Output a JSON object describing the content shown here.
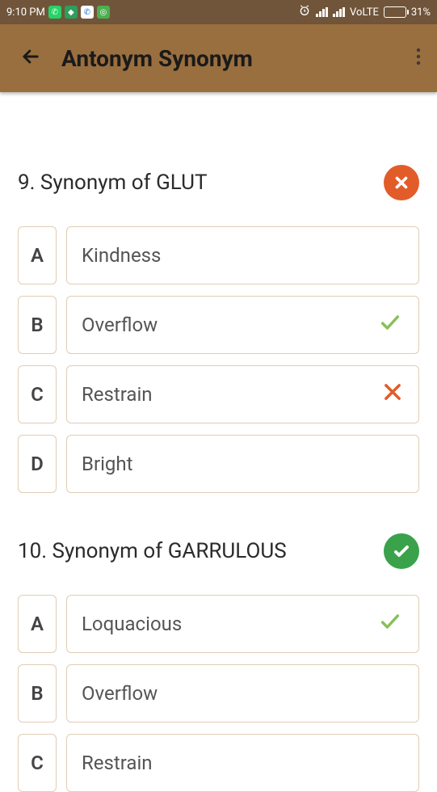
{
  "status": {
    "time": "9:10 PM",
    "volte": "VoLTE",
    "battery": "31%"
  },
  "header": {
    "title": "Antonym Synonym"
  },
  "questions": [
    {
      "number": "9.",
      "prompt": "Synonym of GLUT",
      "status": "wrong",
      "options": [
        {
          "letter": "A",
          "text": "Kindness",
          "mark": "none"
        },
        {
          "letter": "B",
          "text": "Overflow",
          "mark": "check"
        },
        {
          "letter": "C",
          "text": "Restrain",
          "mark": "cross"
        },
        {
          "letter": "D",
          "text": "Bright",
          "mark": "none"
        }
      ]
    },
    {
      "number": "10.",
      "prompt": "Synonym of GARRULOUS",
      "status": "correct",
      "options": [
        {
          "letter": "A",
          "text": "Loquacious",
          "mark": "check"
        },
        {
          "letter": "B",
          "text": "Overflow",
          "mark": "none"
        },
        {
          "letter": "C",
          "text": "Restrain",
          "mark": "none"
        }
      ]
    }
  ]
}
